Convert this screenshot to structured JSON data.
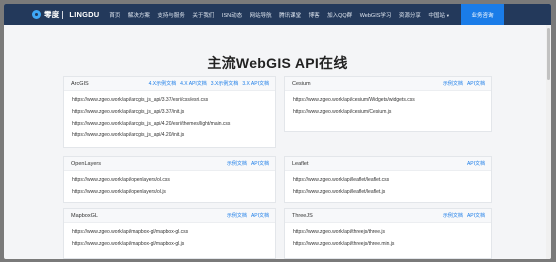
{
  "nav": {
    "logo": {
      "brand": "零度",
      "latin": "LINGDU"
    },
    "links": [
      {
        "label": "首页",
        "caret": ""
      },
      {
        "label": "解决方案",
        "caret": ""
      },
      {
        "label": "支持与服务",
        "caret": ""
      },
      {
        "label": "关于我们",
        "caret": ""
      },
      {
        "label": "ISN动态",
        "caret": ""
      },
      {
        "label": "网站导航",
        "caret": ""
      },
      {
        "label": "腾讯课堂",
        "caret": ""
      },
      {
        "label": "博客",
        "caret": ""
      },
      {
        "label": "加入QQ群",
        "caret": ""
      },
      {
        "label": "WebGIS学习",
        "caret": ""
      },
      {
        "label": "资源分享",
        "caret": ""
      },
      {
        "label": "中国站",
        "caret": "▼"
      }
    ],
    "cta": "业务咨询"
  },
  "page_title": "主流WebGIS API在线",
  "cards": [
    {
      "title": "ArcGIS",
      "links": [
        "4.X示例文档",
        "4.X API文档",
        "3.X示例文档",
        "3.X API文档"
      ],
      "urls": [
        "https://www.zgeo.work/api/arcgis_js_api/3.37/esri/css/esri.css",
        "https://www.zgeo.work/api/arcgis_js_api/3.37/init.js",
        "https://www.zgeo.work/api/arcgis_js_api/4.20/esri/themes/light/main.css",
        "https://www.zgeo.work/api/arcgis_js_api/4.20/init.js"
      ]
    },
    {
      "title": "Cesium",
      "links": [
        "示例文档",
        "API文档"
      ],
      "urls": [
        "https://www.zgeo.work/api/cesium/Widgets/widgets.css",
        "https://www.zgeo.work/api/cesium/Cesium.js"
      ]
    },
    {
      "title": "OpenLayers",
      "links": [
        "示例文档",
        "API文档"
      ],
      "urls": [
        "https://www.zgeo.work/api/openlayers/ol.css",
        "https://www.zgeo.work/api/openlayers/ol.js"
      ]
    },
    {
      "title": "Leaflet",
      "links": [
        "API文档"
      ],
      "urls": [
        "https://www.zgeo.work/api/leaflet/leaflet.css",
        "https://www.zgeo.work/api/leaflet/leaflet.js"
      ]
    },
    {
      "title": "MapboxGL",
      "links": [
        "示例文档",
        "API文档"
      ],
      "urls": [
        "https://www.zgeo.work/api/mapbox-gl/mapbox-gl.css",
        "https://www.zgeo.work/api/mapbox-gl/mapbox-gl.js"
      ]
    },
    {
      "title": "ThreeJS",
      "links": [
        "示例文档",
        "API文档"
      ],
      "urls": [
        "https://www.zgeo.work/api/threejs/three.js",
        "https://www.zgeo.work/api/threejs/three.min.js"
      ]
    }
  ],
  "colors": {
    "nav_bg": "#23395b",
    "accent": "#1a7ce8",
    "page_bg": "#f4f5f7"
  }
}
